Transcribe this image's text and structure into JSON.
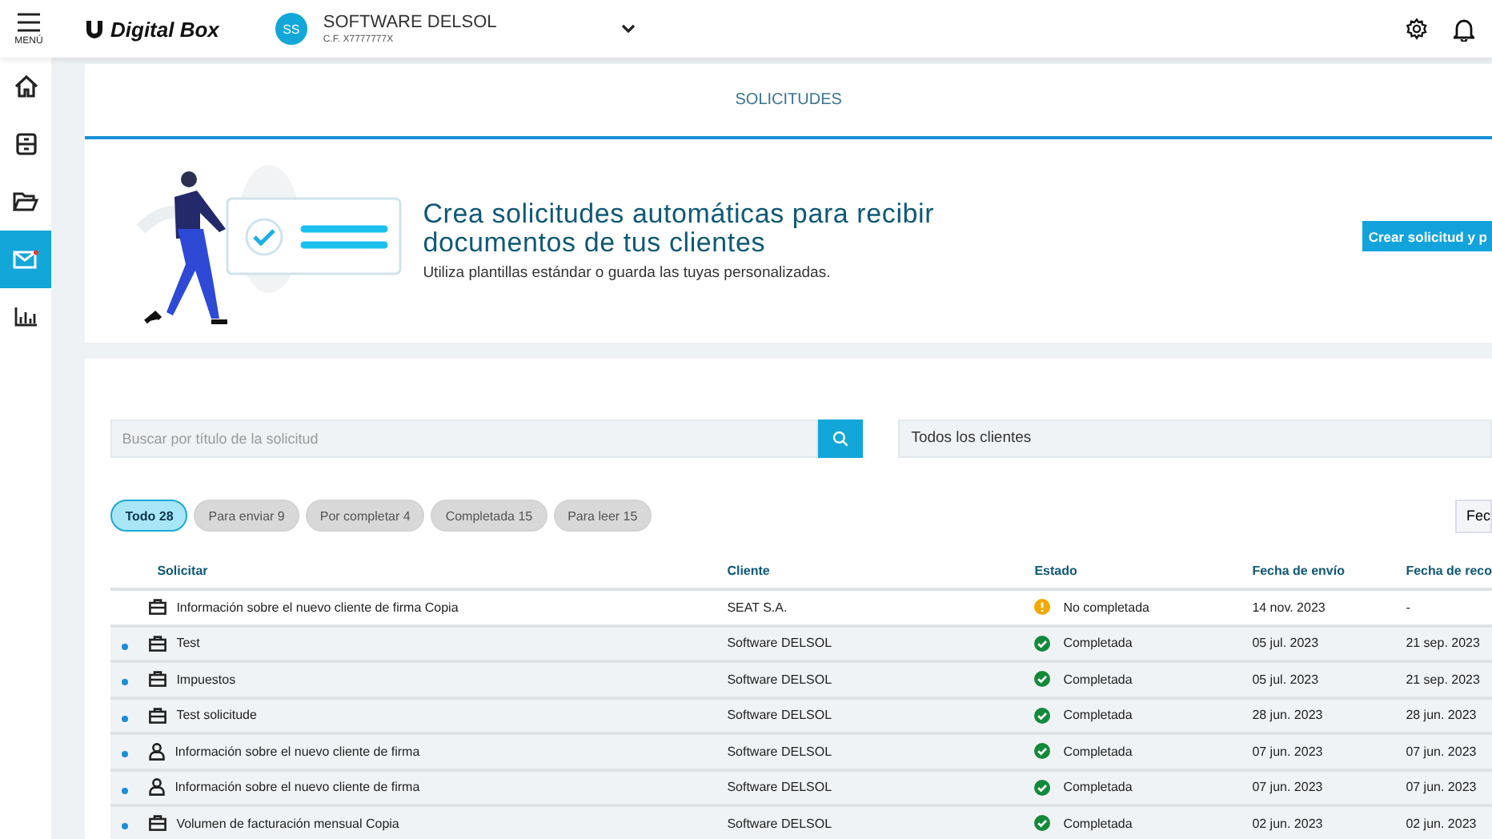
{
  "topbar": {
    "menu_label": "MENÚ",
    "logo_text": "Digital Box",
    "company": {
      "initials": "SS",
      "name": "SOFTWARE DELSOL",
      "tax_id": "C.F. X7777777X"
    }
  },
  "sidebar": {
    "items": [
      {
        "selected": false
      },
      {
        "selected": false
      },
      {
        "selected": false
      },
      {
        "selected": true
      },
      {
        "selected": false
      }
    ]
  },
  "page_title": "SOLICITUDES",
  "banner": {
    "title": "Crea solicitudes automáticas para recibir documentos de tus clientes",
    "subtitle": "Utiliza plantillas estándar o guarda las tuyas personalizadas.",
    "button": "Crear solicitud y p"
  },
  "search": {
    "placeholder": "Buscar por título de la solicitud"
  },
  "client_filter": {
    "value": "Todos los clientes"
  },
  "filters": [
    {
      "label": "Todo 28",
      "selected": true
    },
    {
      "label": "Para enviar 9",
      "selected": false
    },
    {
      "label": "Por completar 4",
      "selected": false
    },
    {
      "label": "Completada 15",
      "selected": false
    },
    {
      "label": "Para leer 15",
      "selected": false
    }
  ],
  "sort_button": "Fec",
  "table": {
    "columns": [
      "Solicitar",
      "Cliente",
      "Estado",
      "Fecha de envío",
      "Fecha de reco"
    ],
    "rows": [
      {
        "unread": false,
        "kind": "briefcase",
        "title": "Información sobre el nuevo cliente de firma Copia",
        "client": "SEAT S.A.",
        "status": {
          "kind": "warning",
          "text": "No completada"
        },
        "sent": "14 nov. 2023",
        "received": "-"
      },
      {
        "unread": true,
        "kind": "briefcase",
        "title": "Test",
        "client": "Software DELSOL",
        "status": {
          "kind": "done",
          "text": "Completada"
        },
        "sent": "05 jul. 2023",
        "received": "21 sep. 2023"
      },
      {
        "unread": true,
        "kind": "briefcase",
        "title": "Impuestos",
        "client": "Software DELSOL",
        "status": {
          "kind": "done",
          "text": "Completada"
        },
        "sent": "05 jul. 2023",
        "received": "21 sep. 2023"
      },
      {
        "unread": true,
        "kind": "briefcase",
        "title": "Test solicitude",
        "client": "Software DELSOL",
        "status": {
          "kind": "done",
          "text": "Completada"
        },
        "sent": "28 jun. 2023",
        "received": "28 jun. 2023"
      },
      {
        "unread": true,
        "kind": "person",
        "title": "Información sobre el nuevo cliente de firma",
        "client": "Software DELSOL",
        "status": {
          "kind": "done",
          "text": "Completada"
        },
        "sent": "07 jun. 2023",
        "received": "07 jun. 2023"
      },
      {
        "unread": true,
        "kind": "person",
        "title": "Información sobre el nuevo cliente de firma",
        "client": "Software DELSOL",
        "status": {
          "kind": "done",
          "text": "Completada"
        },
        "sent": "07 jun. 2023",
        "received": "07 jun. 2023"
      },
      {
        "unread": true,
        "kind": "briefcase",
        "title": "Volumen de facturación mensual Copia",
        "client": "Software DELSOL",
        "status": {
          "kind": "done",
          "text": "Completada"
        },
        "sent": "02 jun. 2023",
        "received": "02 jun. 2023"
      }
    ]
  }
}
